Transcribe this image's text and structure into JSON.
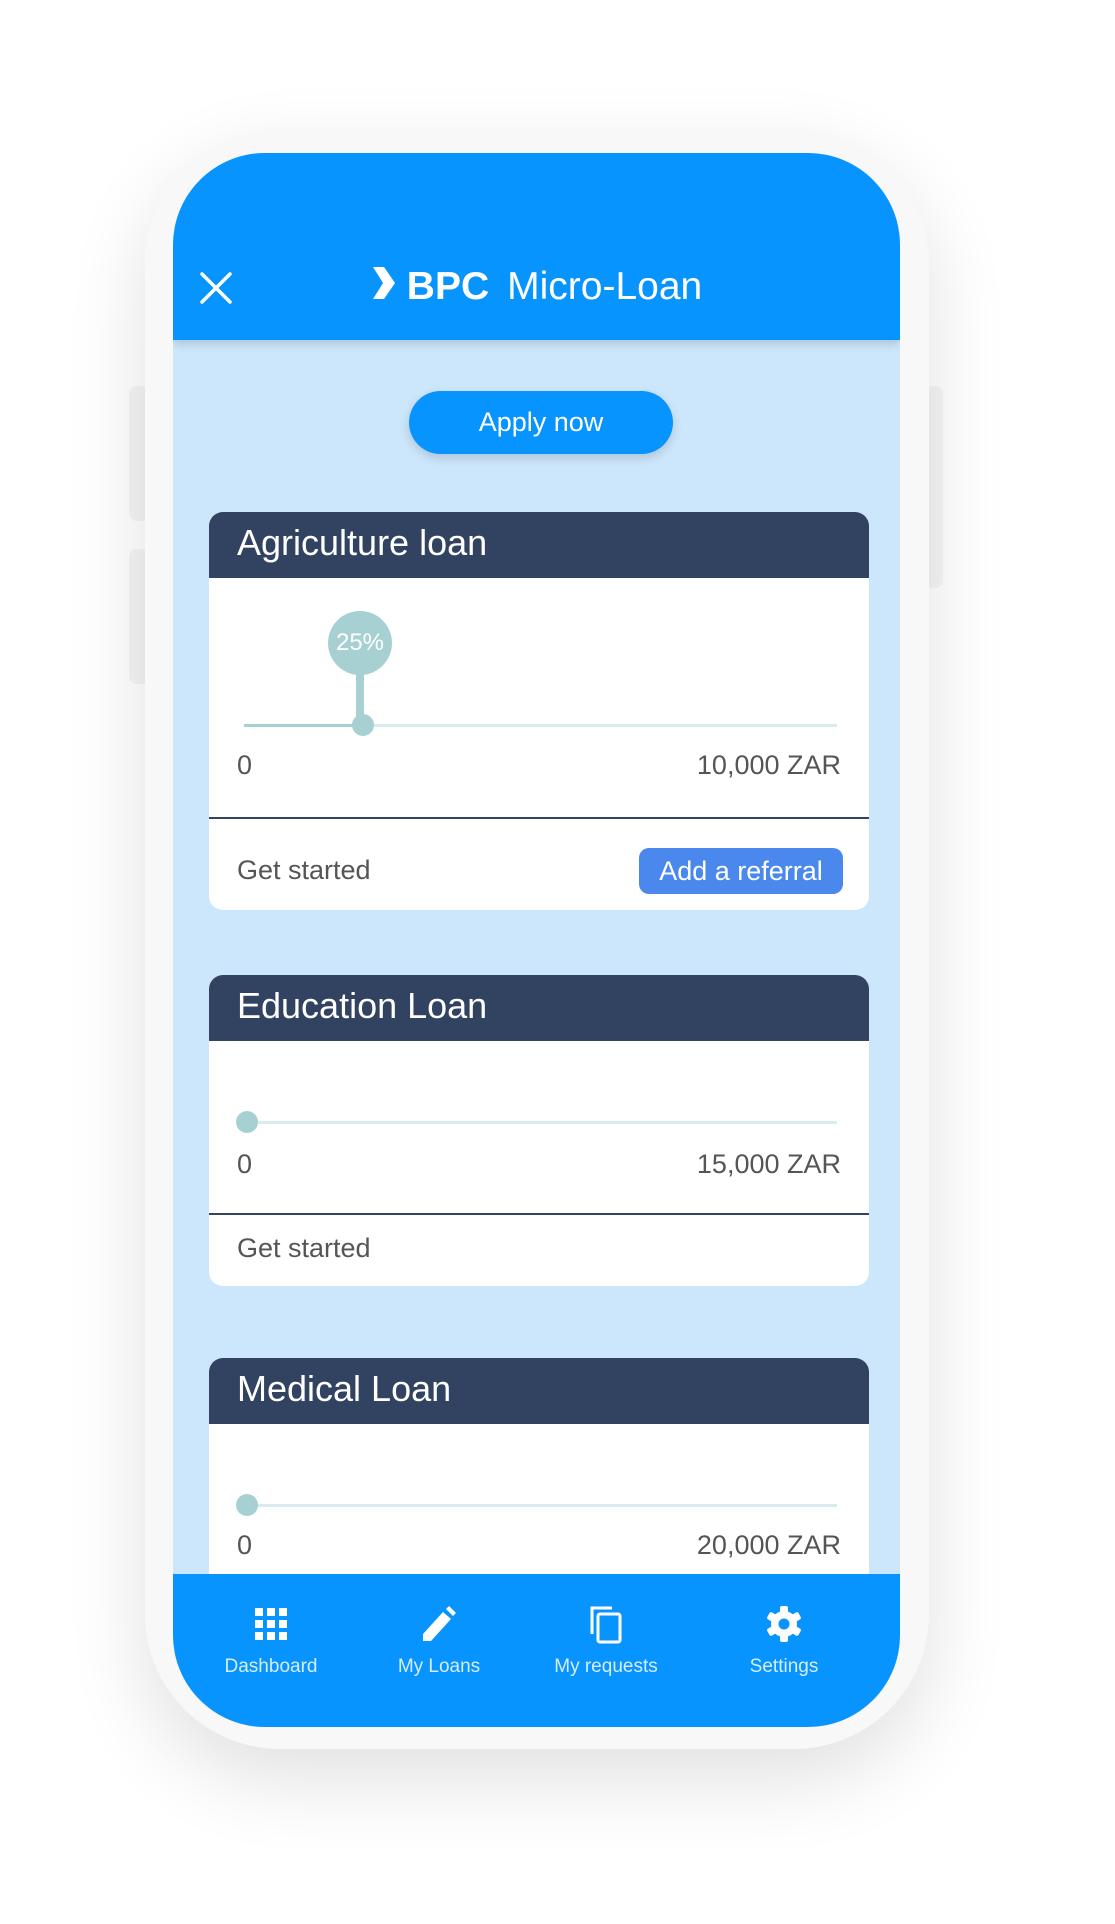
{
  "header": {
    "logo": "BPC",
    "title": "Micro-Loan"
  },
  "apply_label": "Apply now",
  "loans": [
    {
      "title": "Agriculture loan",
      "min": "0",
      "max": "10,000 ZAR",
      "percent_label": "25%",
      "value_fraction": 0.2,
      "footer": "Get started",
      "referral": "Add a referral"
    },
    {
      "title": "Education Loan",
      "min": "0",
      "max": "15,000 ZAR",
      "value_fraction": 0,
      "footer": "Get started"
    },
    {
      "title": "Medical Loan",
      "min": "0",
      "max": "20,000 ZAR",
      "value_fraction": 0
    }
  ],
  "nav": [
    {
      "label": "Dashboard",
      "icon": "grid-icon"
    },
    {
      "label": "My Loans",
      "icon": "pencil-icon"
    },
    {
      "label": "My requests",
      "icon": "copy-icon"
    },
    {
      "label": "Settings",
      "icon": "gear-icon"
    }
  ],
  "colors": {
    "primary": "#0794FE",
    "background": "#CCE6FB",
    "card_header": "#324261",
    "slider": "#A7D0D3",
    "referral": "#4A88EE"
  }
}
